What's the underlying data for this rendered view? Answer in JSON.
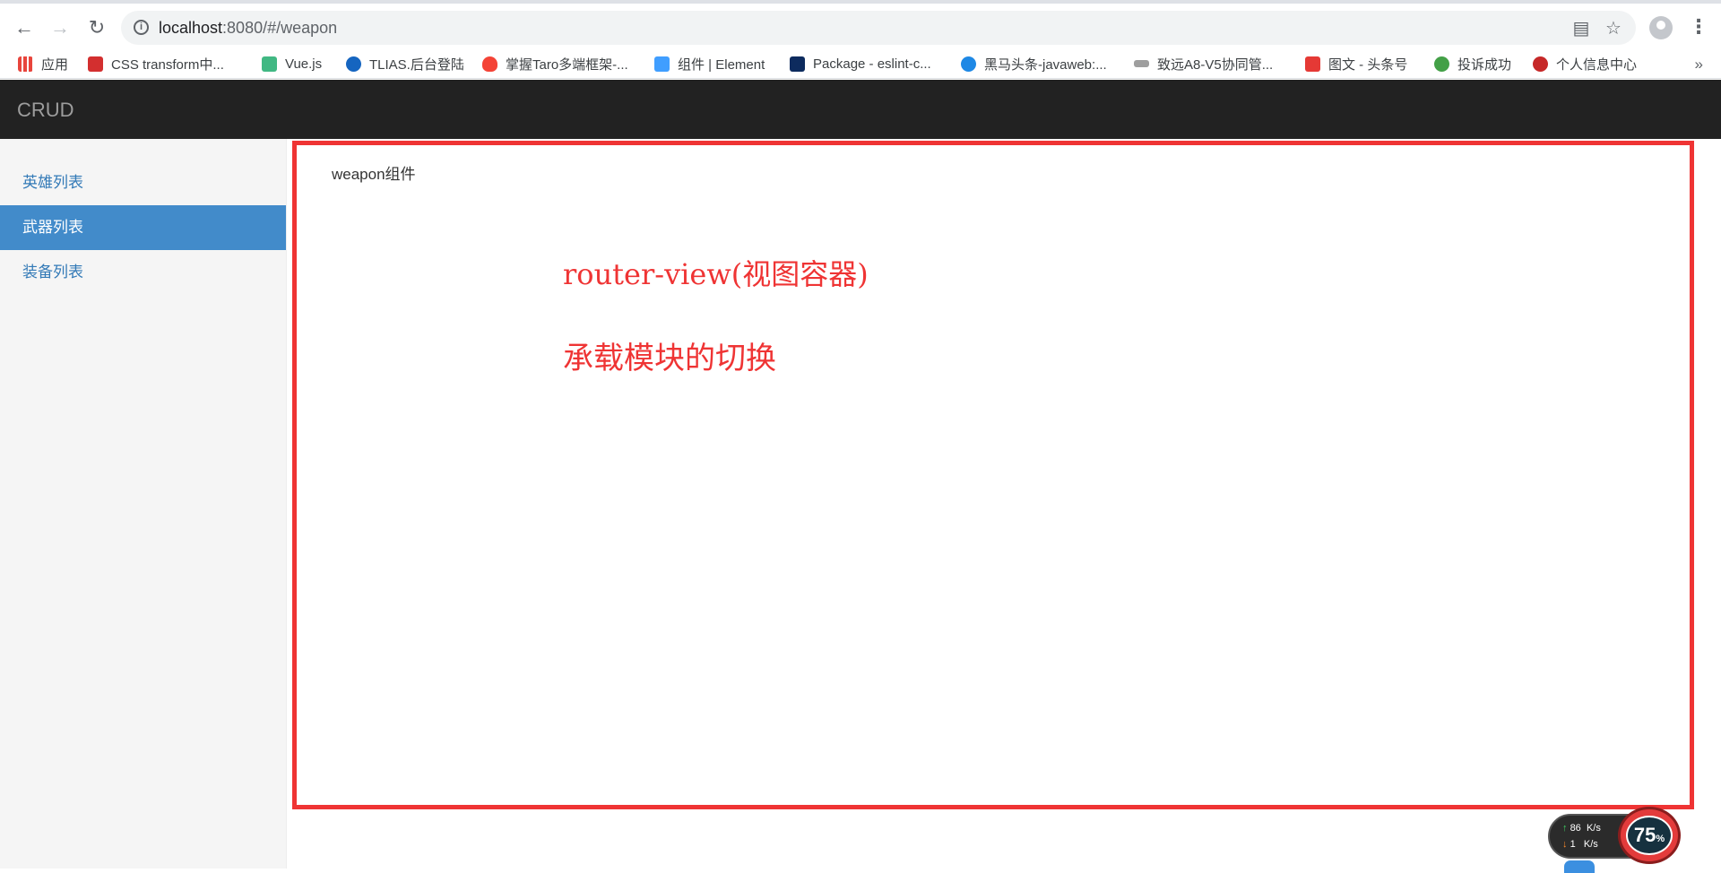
{
  "browser": {
    "url_host": "localhost",
    "url_rest": ":8080/#/weapon",
    "bookmarks": [
      {
        "label": "应用",
        "color": "#e8453c"
      },
      {
        "label": "CSS transform中...",
        "color": "#d32f2f"
      },
      {
        "label": "Vue.js",
        "color": "#41b883"
      },
      {
        "label": "TLIAS.后台登陆",
        "color": "#1565c0"
      },
      {
        "label": "掌握Taro多端框架-...",
        "color": "#f44336"
      },
      {
        "label": "组件 | Element",
        "color": "#409eff"
      },
      {
        "label": "Package - eslint-c...",
        "color": "#0d2b5e"
      },
      {
        "label": "黑马头条-javaweb:...",
        "color": "#1e88e5"
      },
      {
        "label": "致远A8-V5协同管...",
        "color": "#9e9e9e"
      },
      {
        "label": "图文 - 头条号",
        "color": "#e53935"
      },
      {
        "label": "投诉成功",
        "color": "#43a047"
      },
      {
        "label": "个人信息中心",
        "color": "#c62828"
      }
    ],
    "more_label": "»"
  },
  "app": {
    "brand": "CRUD",
    "sidebar": {
      "items": [
        {
          "label": "英雄列表",
          "active": false
        },
        {
          "label": "武器列表",
          "active": true
        },
        {
          "label": "装备列表",
          "active": false
        }
      ]
    },
    "content": {
      "component_title": "weapon组件"
    },
    "annotations": {
      "line1": "router-view(视图容器)",
      "line2": "承载模块的切换",
      "color": "#ef3434"
    }
  },
  "net_widget": {
    "up_value": "86",
    "up_unit": "K/s",
    "down_value": "1",
    "down_unit": "K/s",
    "percent": "75",
    "percent_sign": "%"
  }
}
